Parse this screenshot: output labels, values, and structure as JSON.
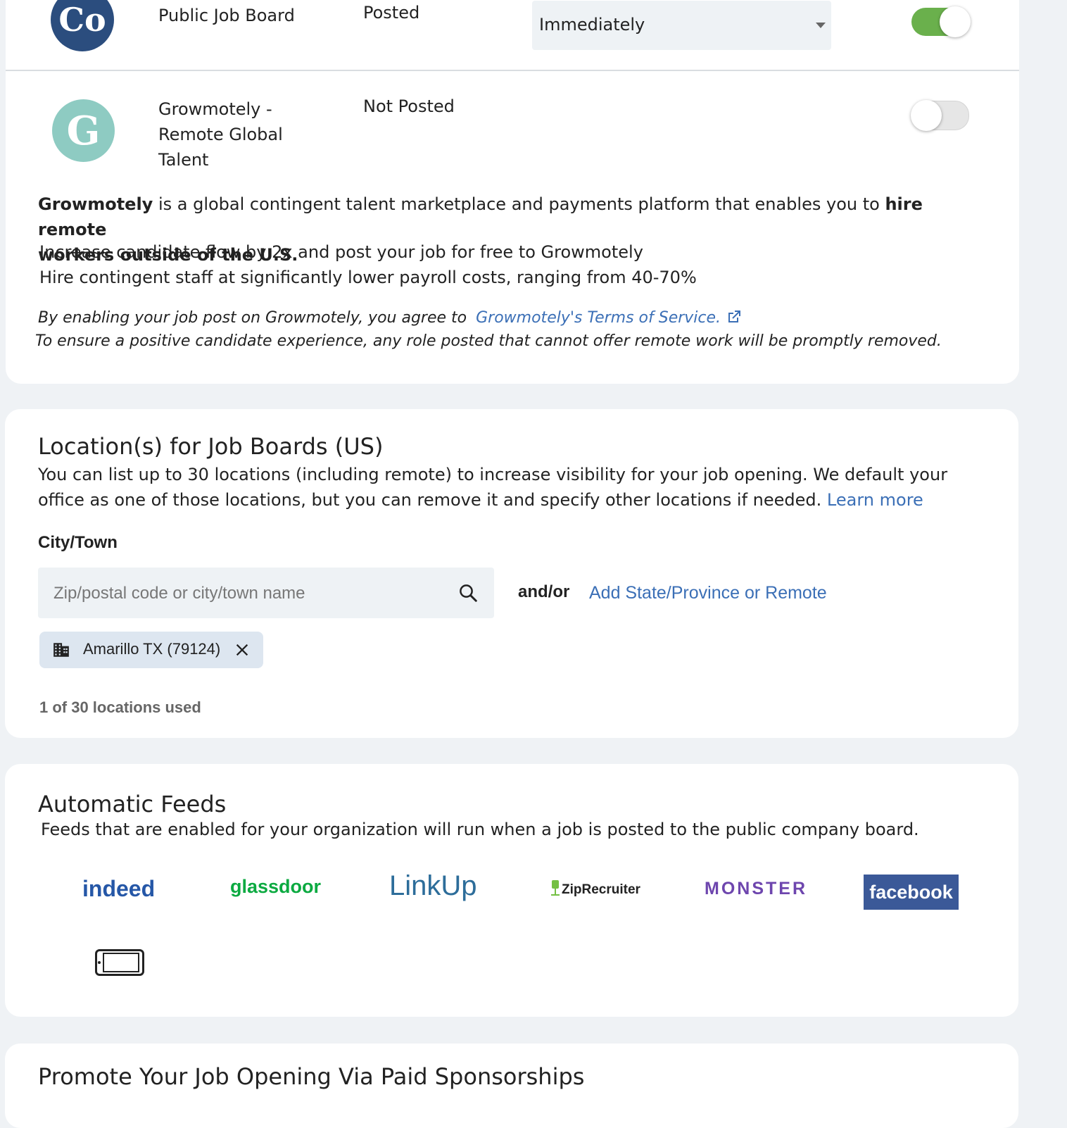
{
  "boards": [
    {
      "logo_letter": "Co",
      "name": "Public Job Board",
      "status": "Posted",
      "schedule": "Immediately",
      "enabled": true
    },
    {
      "logo_letter": "G",
      "name_line1": "Growmotely -",
      "name_line2": "Remote Global",
      "name_line3": "Talent",
      "status": "Not Posted",
      "enabled": false
    }
  ],
  "growmotely_info": {
    "brand": "Growmotely",
    "desc_mid": " is a global contingent talent marketplace and payments platform that enables you to ",
    "desc_bold_end": "hire remote",
    "desc_bold_line2": "workers outside of the U.S.",
    "line2": "Increase candidate flow by 2x and post your job for free to Growmotely",
    "line3": "Hire contingent staff at significantly lower payroll costs, ranging from 40-70%",
    "terms_prefix": "By enabling your job post on Growmotely, you agree to",
    "terms_link": "Growmotely's Terms of Service.",
    "remote_note": "To ensure a positive candidate experience, any role posted that cannot offer remote work will be promptly removed."
  },
  "locations": {
    "title": "Location(s) for Job Boards (US)",
    "desc_line1": "You can list up to 30 locations (including remote) to increase visibility for your job opening. We default your",
    "desc_line2": "office as one of those locations, but you can remove it and specify other locations if needed.",
    "learn_more": "Learn more",
    "city_label": "City/Town",
    "search_placeholder": "Zip/postal code or city/town name",
    "and_or": "and/or",
    "add_state": "Add State/Province or Remote",
    "chip_label": "Amarillo TX (79124)",
    "usage": "1 of 30 locations used"
  },
  "feeds": {
    "title": "Automatic Feeds",
    "desc": "Feeds that are enabled for your organization will run when a job is posted to the public company board.",
    "logos": [
      "indeed",
      "glassdoor",
      "LinkUp",
      "ZipRecruiter",
      "MONSTER",
      "facebook"
    ],
    "icons": [
      "indeed-logo-icon",
      "glassdoor-logo-icon",
      "linkup-logo-icon",
      "ziprecruiter-logo-icon",
      "monster-logo-icon",
      "facebook-logo-icon",
      "mobile-phone-icon"
    ],
    "colors": {
      "indeed": "#2557a7",
      "glassdoor": "#0caa41",
      "linkup": "#2d6d9a",
      "ziprecruiter": "#222222",
      "monster": "#6e46ae",
      "facebook": "#3b5998"
    }
  },
  "promote": {
    "title": "Promote Your Job Opening Via Paid Sponsorships"
  }
}
